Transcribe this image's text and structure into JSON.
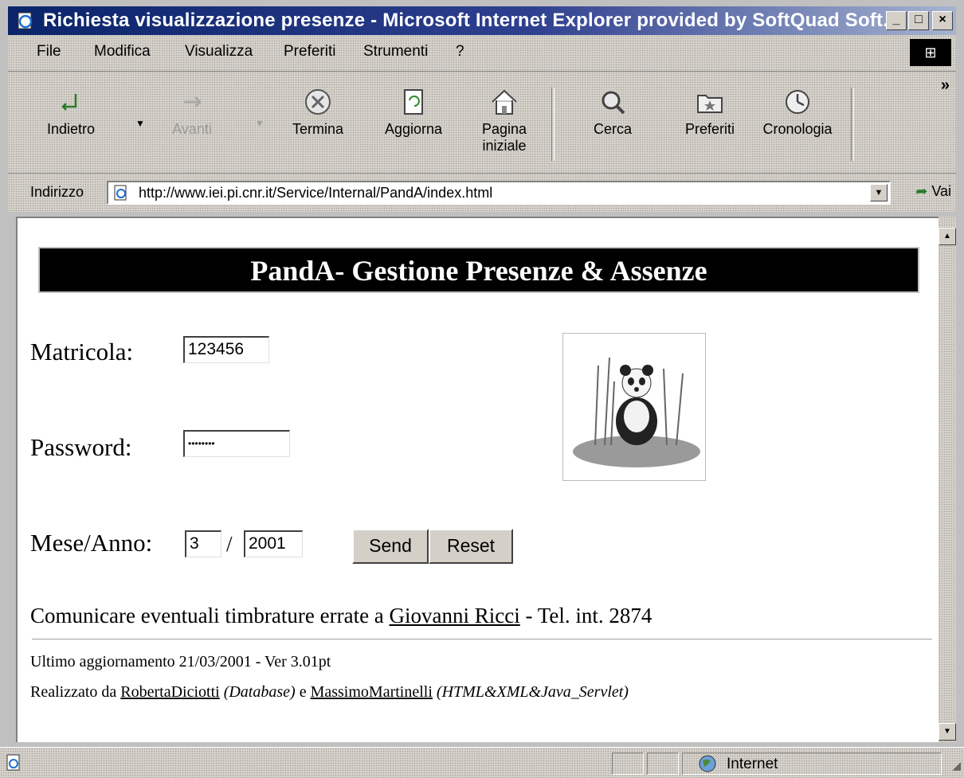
{
  "window": {
    "title": "Richiesta visualizzazione presenze - Microsoft Internet Explorer provided by SoftQuad Soft..."
  },
  "menu": {
    "items": [
      "File",
      "Modifica",
      "Visualizza",
      "Preferiti",
      "Strumenti",
      "?"
    ]
  },
  "toolbar": {
    "back": "Indietro",
    "forward": "Avanti",
    "stop": "Termina",
    "refresh": "Aggiorna",
    "home_line1": "Pagina",
    "home_line2": "iniziale",
    "search": "Cerca",
    "favorites": "Preferiti",
    "history": "Cronologia",
    "more": "»"
  },
  "address": {
    "label": "Indirizzo",
    "url": "http://www.iei.pi.cnr.it/Service/Internal/PandA/index.html",
    "go": "Vai"
  },
  "page": {
    "banner": "PandA- Gestione Presenze & Assenze",
    "matricola_label": "Matricola:",
    "matricola_value": "123456",
    "password_label": "Password:",
    "password_value": "••••••••",
    "mese_anno_label": "Mese/Anno:",
    "mese_value": "3",
    "separator": "/",
    "anno_value": "2001",
    "send": "Send",
    "reset": "Reset",
    "contact_prefix": "Comunicare eventuali timbrature errate a",
    "contact_name": "Giovanni Ricci",
    "contact_suffix": "- Tel. int. 2874",
    "last_update": "Ultimo aggiornamento 21/03/2001 - Ver 3.01pt",
    "credits_prefix": "Realizzato da",
    "credits_author1": "RobertaDiciotti",
    "credits_role1": "(Database)",
    "credits_and": "e",
    "credits_author2": "MassimoMartinelli",
    "credits_role2": "(HTML&XML&Java_Servlet)"
  },
  "status": {
    "zone": "Internet"
  }
}
